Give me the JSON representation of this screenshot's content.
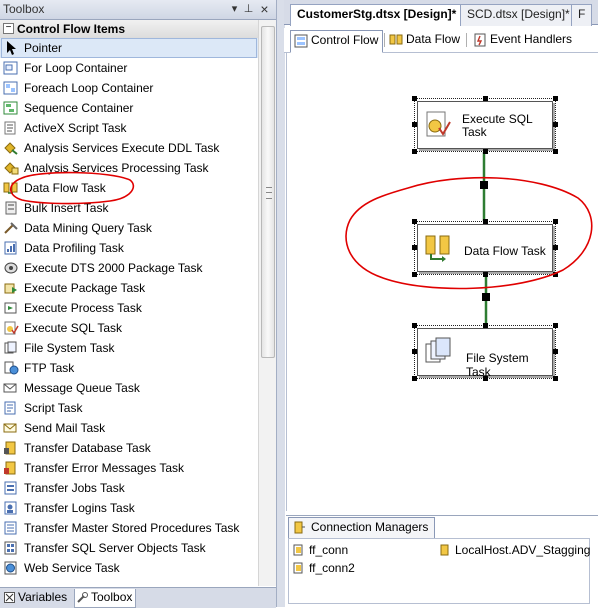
{
  "toolbox": {
    "title": "Toolbox",
    "pin_glyph": "⊥",
    "close_glyph": "×",
    "dropdown_glyph": "▾",
    "group": {
      "toggle": "−",
      "label": "Control Flow Items"
    },
    "items": [
      {
        "label": "Pointer",
        "icon": "pointer-icon"
      },
      {
        "label": "For Loop Container",
        "icon": "for-loop-icon"
      },
      {
        "label": "Foreach Loop Container",
        "icon": "foreach-loop-icon"
      },
      {
        "label": "Sequence Container",
        "icon": "sequence-container-icon"
      },
      {
        "label": "ActiveX Script Task",
        "icon": "activex-script-icon"
      },
      {
        "label": "Analysis Services Execute DDL Task",
        "icon": "analysis-ddl-icon"
      },
      {
        "label": "Analysis Services Processing Task",
        "icon": "analysis-processing-icon"
      },
      {
        "label": "Data Flow Task",
        "icon": "data-flow-icon"
      },
      {
        "label": "Bulk Insert Task",
        "icon": "bulk-insert-icon"
      },
      {
        "label": "Data Mining Query Task",
        "icon": "data-mining-icon"
      },
      {
        "label": "Data Profiling Task",
        "icon": "data-profiling-icon"
      },
      {
        "label": "Execute DTS 2000 Package Task",
        "icon": "dts-package-icon"
      },
      {
        "label": "Execute Package Task",
        "icon": "execute-package-icon"
      },
      {
        "label": "Execute Process Task",
        "icon": "execute-process-icon"
      },
      {
        "label": "Execute SQL Task",
        "icon": "execute-sql-icon"
      },
      {
        "label": "File System Task",
        "icon": "file-system-icon"
      },
      {
        "label": "FTP Task",
        "icon": "ftp-icon"
      },
      {
        "label": "Message Queue Task",
        "icon": "message-queue-icon"
      },
      {
        "label": "Script Task",
        "icon": "script-icon"
      },
      {
        "label": "Send Mail Task",
        "icon": "send-mail-icon"
      },
      {
        "label": "Transfer Database Task",
        "icon": "transfer-database-icon"
      },
      {
        "label": "Transfer Error Messages Task",
        "icon": "transfer-error-icon"
      },
      {
        "label": "Transfer Jobs Task",
        "icon": "transfer-jobs-icon"
      },
      {
        "label": "Transfer Logins Task",
        "icon": "transfer-logins-icon"
      },
      {
        "label": "Transfer Master Stored Procedures Task",
        "icon": "transfer-stored-procedures-icon"
      },
      {
        "label": "Transfer SQL Server Objects Task",
        "icon": "transfer-sql-objects-icon"
      },
      {
        "label": "Web Service Task",
        "icon": "web-service-icon"
      }
    ],
    "bottom_tabs": [
      {
        "label": "Variables",
        "icon": "variables-icon"
      },
      {
        "label": "Toolbox",
        "icon": "toolbox-icon"
      }
    ]
  },
  "document_tabs": [
    {
      "label": "CustomerStg.dtsx [Design]*",
      "close": "×"
    },
    {
      "label": "SCD.dtsx [Design]*"
    },
    {
      "label": "F"
    }
  ],
  "designer_tabs": [
    {
      "label": "Control Flow",
      "icon": "control-flow-icon"
    },
    {
      "label": "Data Flow",
      "icon": "data-flow-tab-icon"
    },
    {
      "label": "Event Handlers",
      "icon": "event-handlers-icon"
    }
  ],
  "canvas": {
    "tasks": [
      {
        "label_line1": "Execute SQL",
        "label_line2": "Task",
        "icon": "execute-sql-task-icon"
      },
      {
        "label": "Data Flow Task",
        "icon": "data-flow-task-icon"
      },
      {
        "label": "File System Task",
        "icon": "file-system-task-icon"
      }
    ]
  },
  "connection_managers": {
    "tab_label": "Connection Managers",
    "items": [
      {
        "label": "ff_conn"
      },
      {
        "label": "ff_conn2"
      },
      {
        "label": "LocalHost.ADV_Stagging"
      }
    ]
  },
  "colors": {
    "precedence_line": "#2e7d32",
    "annotation": "#e00000",
    "selection": "#dce8f7"
  }
}
